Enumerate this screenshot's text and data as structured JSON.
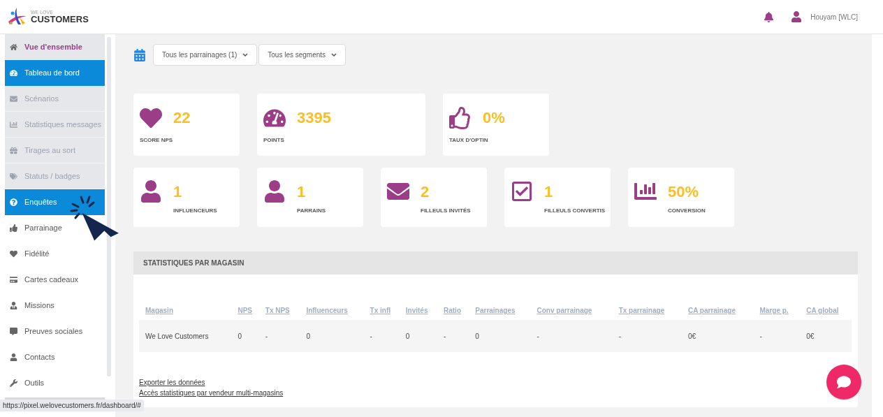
{
  "header": {
    "logo_small": "WE LOVE",
    "logo_big": "CUSTOMERS",
    "user_name": "Houyam [WLC]"
  },
  "sidebar": {
    "items": [
      {
        "label": "Vue d'ensemble",
        "selected": false,
        "expanded": true,
        "children": [
          {
            "label": "Tableau de bord",
            "selected": true
          },
          {
            "label": "Scénarios",
            "selected": false
          },
          {
            "label": "Statistiques messages",
            "selected": false
          },
          {
            "label": "Tirages au sort",
            "selected": false
          },
          {
            "label": "Statuts / badges",
            "selected": false
          },
          {
            "label": "Enquêtes",
            "selected": true
          }
        ]
      },
      {
        "label": "Parrainage",
        "selected": false
      },
      {
        "label": "Fidélité",
        "selected": false
      },
      {
        "label": "Cartes cadeaux",
        "selected": false
      },
      {
        "label": "Missions",
        "selected": false
      },
      {
        "label": "Preuves sociales",
        "selected": false
      },
      {
        "label": "Contacts",
        "selected": false
      },
      {
        "label": "Outils",
        "selected": false
      }
    ]
  },
  "filters": [
    {
      "value": "Tous les parrainages (1)"
    },
    {
      "value": "Tous les segments"
    }
  ],
  "primary_stats": [
    {
      "value": "22",
      "label": "SCORE NPS"
    },
    {
      "value": "3395",
      "label": "POINTS"
    },
    {
      "value": "0%",
      "label": "TAUX D'OPTIN"
    }
  ],
  "secondary_stats": [
    {
      "value": "1",
      "label": "INFLUENCEURS"
    },
    {
      "value": "1",
      "label": "PARRAINS"
    },
    {
      "value": "2",
      "label": "FILLEULS INVITÉS"
    },
    {
      "value": "1",
      "label": "FILLEULS CONVERTIS"
    },
    {
      "value": "50%",
      "label": "CONVERSION"
    }
  ],
  "store_stats": {
    "title": "STATISTIQUES PAR MAGASIN",
    "columns": [
      "Magasin",
      "NPS",
      "Tx NPS",
      "Influenceurs",
      "Tx infl",
      "Invités",
      "Ratio",
      "Parrainages",
      "Conv parrainage",
      "Tx parrainage",
      "CA parrainage",
      "Marge p.",
      "CA global"
    ],
    "rows": [
      [
        "We Love Customers",
        "0",
        "-",
        "0",
        "-",
        "0",
        "-",
        "0",
        "-",
        "-",
        "0€",
        "-",
        "0€"
      ]
    ],
    "links": [
      "Exporter les données",
      "Accès statistiques par vendeur multi-magasins"
    ]
  },
  "status_url": "https://pixel.welovecustomers.fr/dashboard/#"
}
